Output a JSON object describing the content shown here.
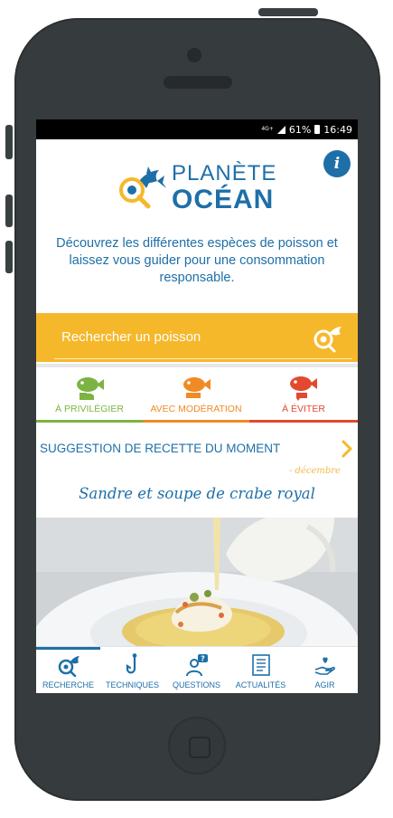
{
  "status_bar": {
    "network": "4G+",
    "battery": "61%",
    "time": "16:49"
  },
  "header": {
    "brand_line1": "PLANÈTE",
    "brand_line2": "OCÉAN",
    "tagline": "Découvrez les différentes espèces de poisson et laissez vous guider pour une consommation responsable.",
    "info_label": "i"
  },
  "search": {
    "placeholder": "Rechercher un poisson"
  },
  "categories": [
    {
      "label": "À PRIVILÉGIER",
      "color": "#7cb342"
    },
    {
      "label": "AVEC MODÉRATION",
      "color": "#f08a24"
    },
    {
      "label": "À ÉVITER",
      "color": "#e2492f"
    }
  ],
  "suggestion": {
    "heading": "SUGGESTION DE RECETTE DU MOMENT",
    "date": "- décembre",
    "recipe_title": "Sandre et soupe de crabe royal"
  },
  "nav": [
    {
      "label": "RECHERCHE",
      "icon": "search-fish-icon",
      "active": true
    },
    {
      "label": "TECHNIQUES",
      "icon": "fishhook-icon"
    },
    {
      "label": "QUESTIONS",
      "icon": "question-person-icon"
    },
    {
      "label": "ACTUALITÉS",
      "icon": "news-icon"
    },
    {
      "label": "AGIR",
      "icon": "hand-heart-icon"
    }
  ],
  "colors": {
    "primary": "#1e6fa8",
    "accent": "#f6b82b"
  }
}
